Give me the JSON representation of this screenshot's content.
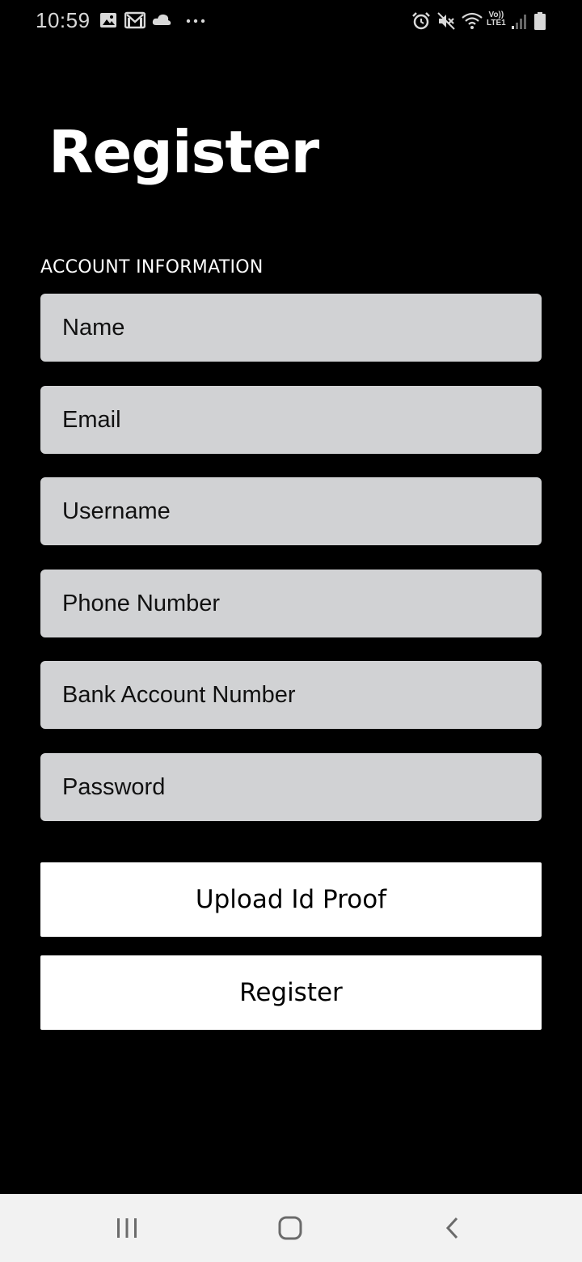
{
  "status_bar": {
    "time": "10:59",
    "lte_line1": "Vo))",
    "lte_line2": "LTE1",
    "icons": [
      "gallery-icon",
      "gmail-icon",
      "cloud-icon",
      "more-dots-icon",
      "alarm-icon",
      "mute-icon",
      "wifi-icon",
      "signal-icon",
      "battery-icon"
    ]
  },
  "page": {
    "title": "Register",
    "section_label": "ACCOUNT INFORMATION"
  },
  "form": {
    "name_placeholder": "Name",
    "email_placeholder": "Email",
    "username_placeholder": "Username",
    "phone_placeholder": "Phone Number",
    "bank_placeholder": "Bank Account Number",
    "password_placeholder": "Password"
  },
  "buttons": {
    "upload_label": "Upload Id Proof",
    "register_label": "Register"
  },
  "nav": {
    "icons": [
      "recent-apps-icon",
      "home-icon",
      "back-icon"
    ]
  },
  "colors": {
    "background": "#000000",
    "field_bg": "#d1d2d4",
    "button_bg": "#ffffff",
    "nav_bg": "#f2f2f2"
  }
}
